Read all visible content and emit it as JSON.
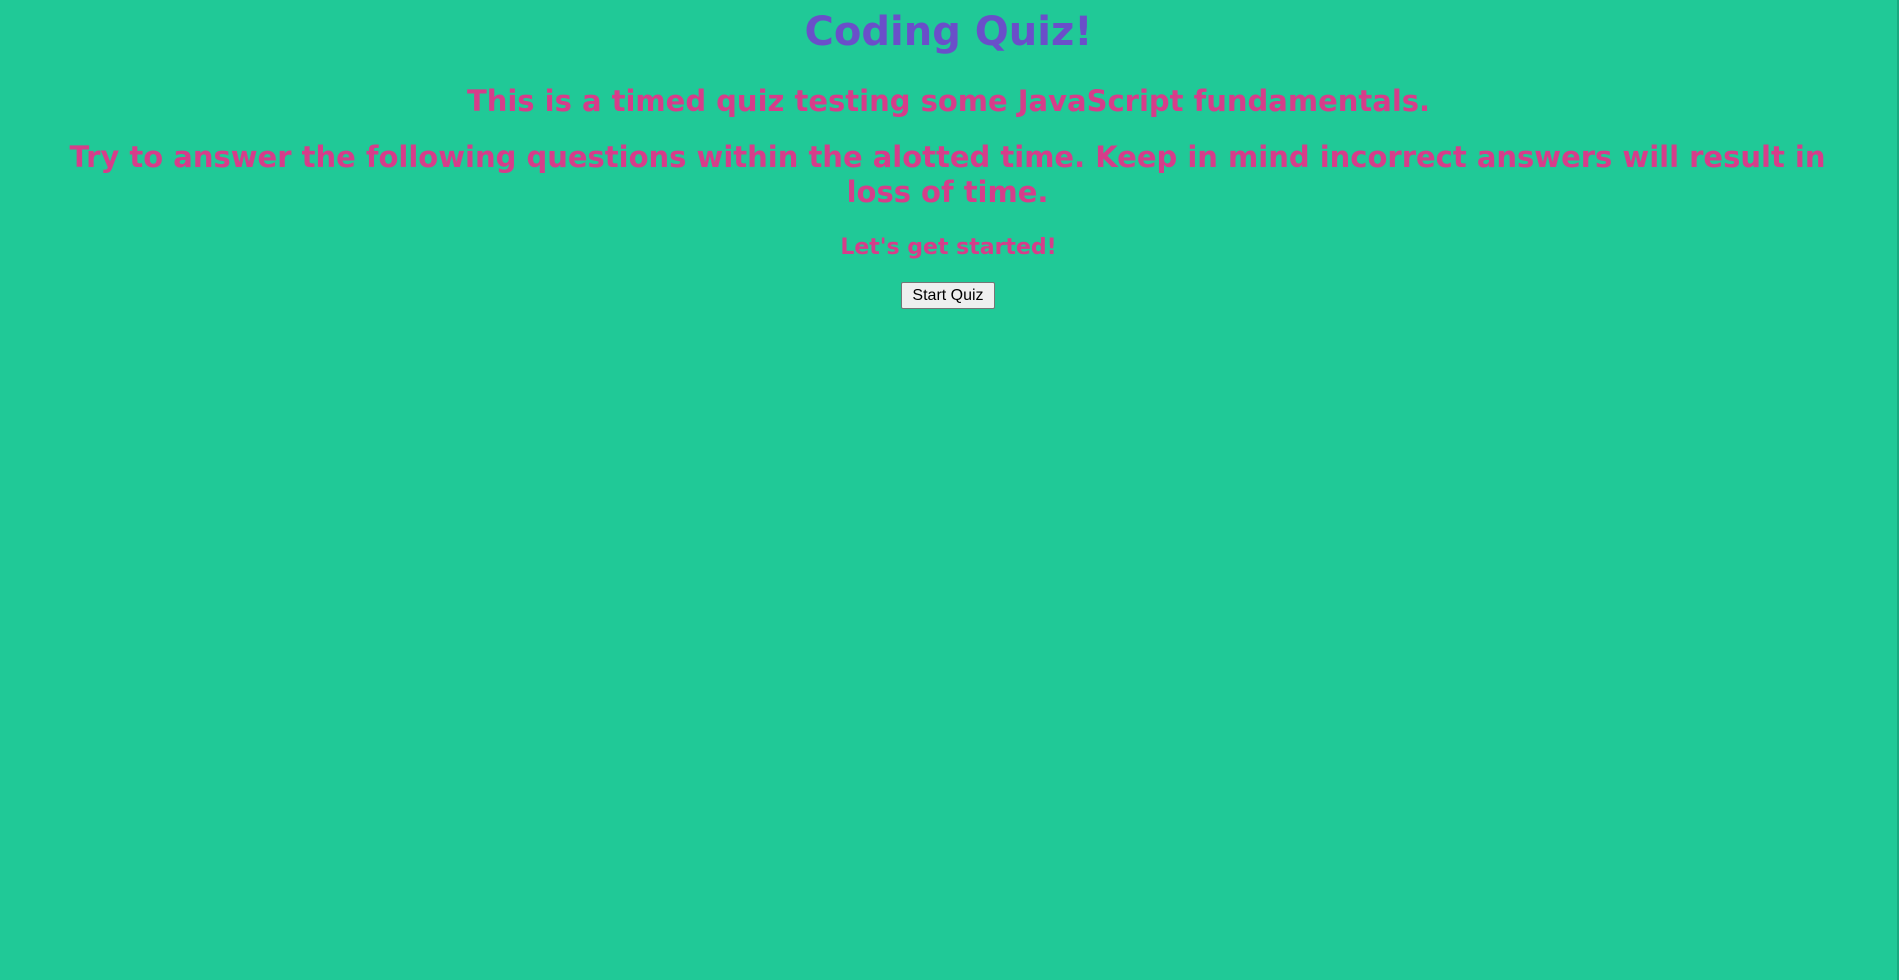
{
  "page": {
    "title": "Coding Quiz!",
    "intro": "This is a timed quiz testing some JavaScript fundamentals.",
    "instructions": "Try to answer the following questions within the alotted time. Keep in mind incorrect answers will result in loss of time.",
    "start_prompt": "Let's get started!",
    "start_button_label": "Start Quiz"
  },
  "colors": {
    "background": "#20c997",
    "title": "#6a4fc9",
    "text": "#d63d8a"
  }
}
